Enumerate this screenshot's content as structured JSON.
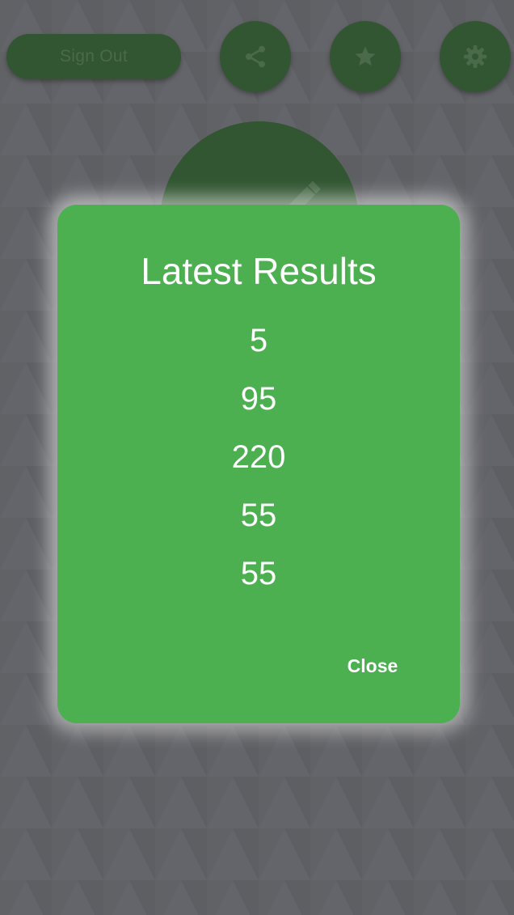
{
  "top_bar": {
    "sign_out_label": "Sign Out",
    "share_icon": "share-icon",
    "favorites_icon": "star-icon",
    "settings_icon": "gear-icon"
  },
  "fab": {
    "icon": "pencil-icon"
  },
  "dialog": {
    "title": "Latest Results",
    "results": [
      "5",
      "95",
      "220",
      "55",
      "55"
    ],
    "close_label": "Close"
  },
  "colors": {
    "dialog_background": "#4caf50",
    "button_background": "#2f5f2c",
    "screen_background": "#6e6f73",
    "text": "#ffffff"
  }
}
